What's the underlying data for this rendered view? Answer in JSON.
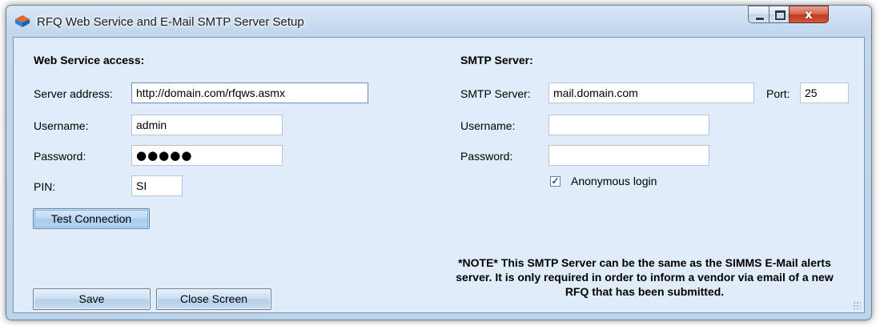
{
  "window": {
    "title": "RFQ Web Service and E-Mail SMTP Server Setup",
    "icons": {
      "app": "app-logo-icon",
      "minimize": "minimize-icon",
      "maximize": "maximize-icon",
      "close": "close-icon"
    },
    "close_glyph": "x"
  },
  "web_service": {
    "heading": "Web Service access:",
    "server_address_label": "Server address:",
    "server_address_value": "http://domain.com/rfqws.asmx",
    "username_label": "Username:",
    "username_value": "admin",
    "password_label": "Password:",
    "password_mask": "●●●●●",
    "pin_label": "PIN:",
    "pin_value": "SI",
    "test_connection_label": "Test Connection"
  },
  "smtp": {
    "heading": "SMTP Server:",
    "server_label": "SMTP Server:",
    "server_value": "mail.domain.com",
    "port_label": "Port:",
    "port_value": "25",
    "username_label": "Username:",
    "username_value": "",
    "password_label": "Password:",
    "password_value": "",
    "anonymous_label": "Anonymous login",
    "anonymous_checked": true,
    "check_glyph": "✓"
  },
  "footer": {
    "save_label": "Save",
    "close_label": "Close Screen",
    "note": "*NOTE* This SMTP Server can be the same as the SIMMS E-Mail alerts server. It is only required in order to inform a vendor via email of a new RFQ that has been submitted."
  },
  "colors": {
    "accent_blue": "#2f7fd8",
    "close_red": "#c0391d",
    "client_bg": "#e0ecf9"
  }
}
